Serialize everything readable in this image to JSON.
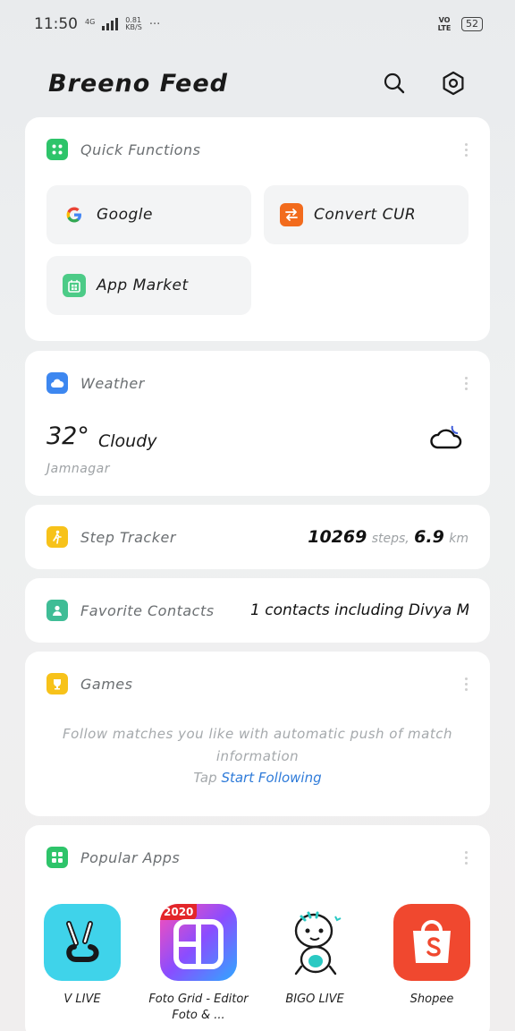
{
  "status_bar": {
    "time": "11:50",
    "network_tag": "4G",
    "speed_value": "0.81",
    "speed_unit": "KB/S",
    "more": "···",
    "volte": "VO LTE",
    "battery": "52"
  },
  "header": {
    "title": "Breeno Feed",
    "search_icon": "search-icon",
    "settings_icon": "settings-icon"
  },
  "quick_functions": {
    "title": "Quick Functions",
    "items": [
      {
        "label": "Google",
        "icon": "google-icon"
      },
      {
        "label": "Convert CUR",
        "icon": "currency-convert-icon",
        "color": "#f26b1d"
      },
      {
        "label": "App Market",
        "icon": "app-market-icon",
        "color": "#4ccb87"
      }
    ]
  },
  "weather": {
    "title": "Weather",
    "temperature": "32°",
    "condition": "Cloudy",
    "city": "Jamnagar",
    "icon": "cloudy-moon-icon"
  },
  "step_tracker": {
    "title": "Step Tracker",
    "steps": "10269",
    "steps_unit": "steps,",
    "distance": "6.9",
    "distance_unit": "km"
  },
  "favorite_contacts": {
    "title": "Favorite Contacts",
    "summary": "1 contacts including Divya M..."
  },
  "games": {
    "title": "Games",
    "message": "Follow matches you like with automatic push of match information",
    "tap_label": "Tap",
    "link_label": "Start Following"
  },
  "popular_apps": {
    "title": "Popular Apps",
    "apps": [
      {
        "label": "V LIVE",
        "icon": "vlive-icon"
      },
      {
        "label": "Foto Grid - Editor Foto & ...",
        "icon": "fotogrid-icon",
        "badge": "2020"
      },
      {
        "label": "BIGO LIVE",
        "icon": "bigo-live-icon"
      },
      {
        "label": "Shopee",
        "icon": "shopee-icon"
      }
    ]
  },
  "colors": {
    "quick_icon": "#2ec46a",
    "weather_icon": "#3d87f0",
    "step_icon": "#f7c21a",
    "contacts_icon": "#3fbd96",
    "games_icon": "#f7c21a",
    "popular_icon": "#2ec46a",
    "link": "#2f7bd9"
  }
}
